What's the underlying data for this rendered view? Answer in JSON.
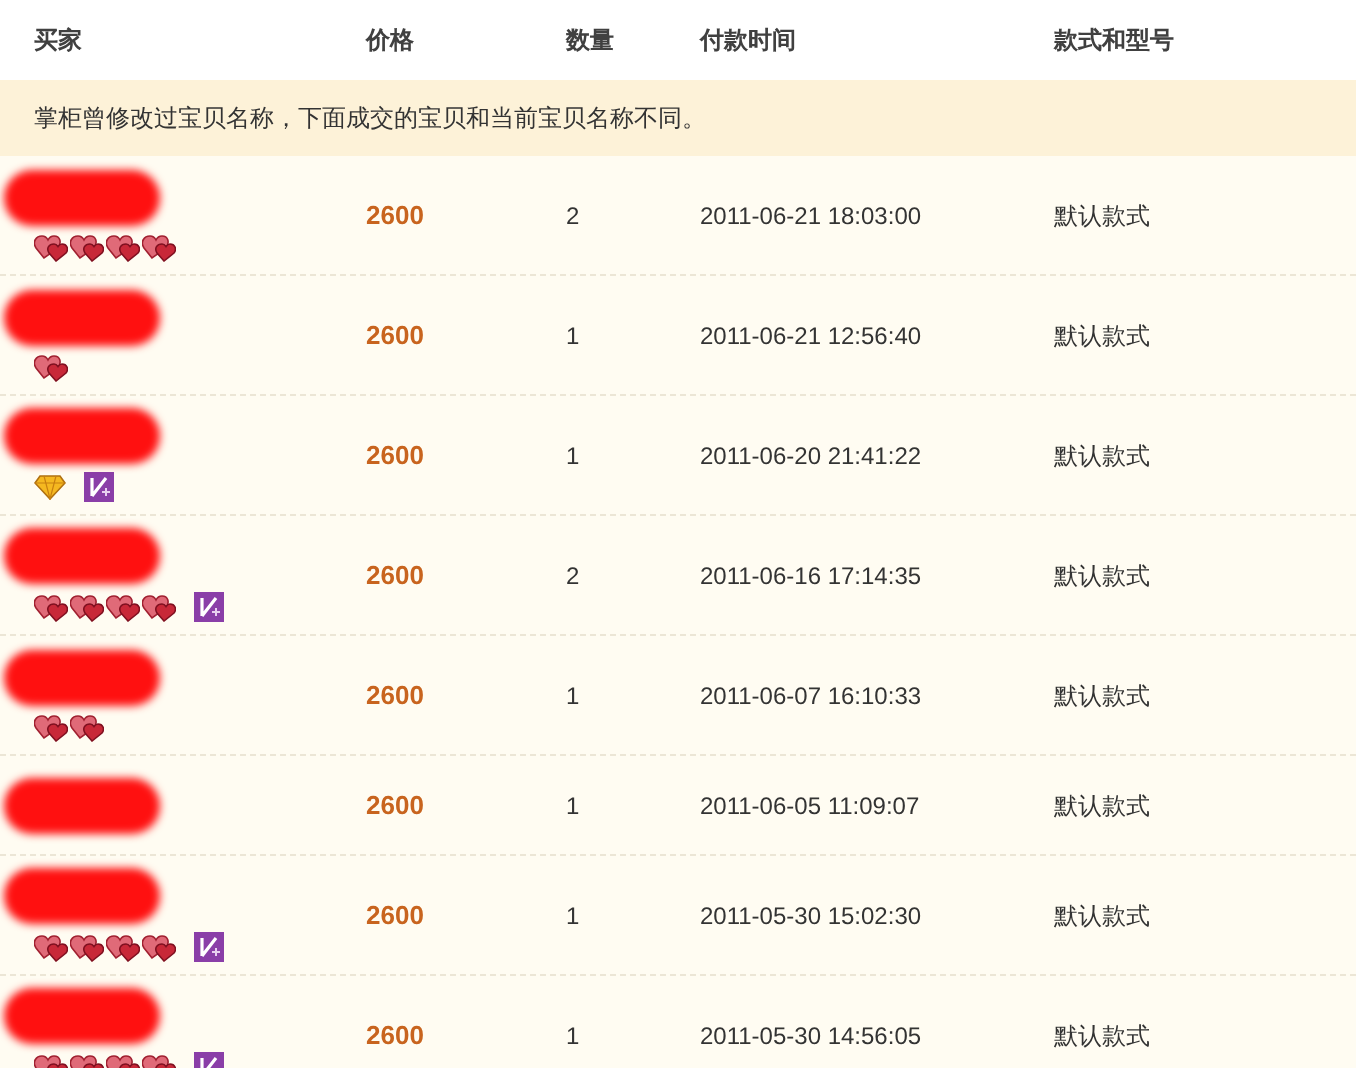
{
  "columns": [
    "买家",
    "价格",
    "数量",
    "付款时间",
    "款式和型号"
  ],
  "notice": "掌柜曾修改过宝贝名称，下面成交的宝贝和当前宝贝名称不同。",
  "rows": [
    {
      "marks": [
        {
          "kind": "heart"
        },
        {
          "kind": "heart"
        },
        {
          "kind": "heart"
        },
        {
          "kind": "heart"
        }
      ],
      "price": "2600",
      "quantity": "2",
      "paid_at": "2011-06-21 18:03:00",
      "style": "默认款式"
    },
    {
      "marks": [
        {
          "kind": "heart"
        }
      ],
      "price": "2600",
      "quantity": "1",
      "paid_at": "2011-06-21 12:56:40",
      "style": "默认款式"
    },
    {
      "marks": [
        {
          "kind": "diamond"
        },
        {
          "kind": "badge"
        }
      ],
      "price": "2600",
      "quantity": "1",
      "paid_at": "2011-06-20 21:41:22",
      "style": "默认款式"
    },
    {
      "marks": [
        {
          "kind": "heart"
        },
        {
          "kind": "heart"
        },
        {
          "kind": "heart"
        },
        {
          "kind": "heart"
        },
        {
          "kind": "badge"
        }
      ],
      "price": "2600",
      "quantity": "2",
      "paid_at": "2011-06-16 17:14:35",
      "style": "默认款式"
    },
    {
      "marks": [
        {
          "kind": "heart"
        },
        {
          "kind": "heart"
        }
      ],
      "price": "2600",
      "quantity": "1",
      "paid_at": "2011-06-07 16:10:33",
      "style": "默认款式"
    },
    {
      "price": "2600",
      "quantity": "1",
      "paid_at": "2011-06-05 11:09:07",
      "style": "默认款式"
    },
    {
      "marks": [
        {
          "kind": "heart"
        },
        {
          "kind": "heart"
        },
        {
          "kind": "heart"
        },
        {
          "kind": "heart"
        },
        {
          "kind": "badge"
        }
      ],
      "price": "2600",
      "quantity": "1",
      "paid_at": "2011-05-30 15:02:30",
      "style": "默认款式"
    },
    {
      "marks": [
        {
          "kind": "heart"
        },
        {
          "kind": "heart"
        },
        {
          "kind": "heart"
        },
        {
          "kind": "heart"
        },
        {
          "kind": "badge"
        }
      ],
      "price": "2600",
      "quantity": "1",
      "paid_at": "2011-05-30 14:56:05",
      "style": "默认款式"
    }
  ]
}
